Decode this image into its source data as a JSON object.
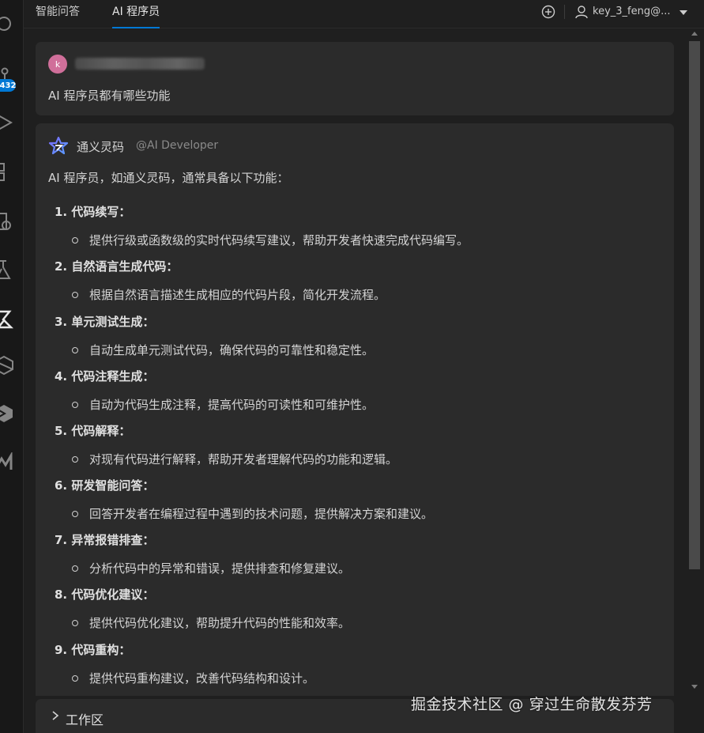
{
  "tabs": [
    {
      "label": "智能问答"
    },
    {
      "label": "AI 程序员"
    }
  ],
  "header": {
    "user_name": "key_3_feng@...",
    "add_icon": "add-circle-icon",
    "user_icon": "account-icon",
    "dropdown_icon": "caret-down-icon"
  },
  "activity_bar": {
    "badge": "432",
    "icons": [
      "search-icon",
      "source-control-icon",
      "run-debug-icon",
      "extensions-icon",
      "remote-icon",
      "testing-icon",
      "tongyi-lingma-icon",
      "hexagon-icon",
      "cube-icon",
      "chart-icon"
    ]
  },
  "question": {
    "avatar_letter": "k",
    "text": "AI 程序员都有哪些功能"
  },
  "answer": {
    "author": "通义灵码",
    "handle": "@AI Developer",
    "intro": "AI 程序员，如通义灵码，通常具备以下功能：",
    "items": [
      {
        "title": "1. 代码续写：",
        "desc": "提供行级或函数级的实时代码续写建议，帮助开发者快速完成代码编写。"
      },
      {
        "title": "2. 自然语言生成代码：",
        "desc": "根据自然语言描述生成相应的代码片段，简化开发流程。"
      },
      {
        "title": "3. 单元测试生成：",
        "desc": "自动生成单元测试代码，确保代码的可靠性和稳定性。"
      },
      {
        "title": "4. 代码注释生成：",
        "desc": "自动为代码生成注释，提高代码的可读性和可维护性。"
      },
      {
        "title": "5. 代码解释：",
        "desc": "对现有代码进行解释，帮助开发者理解代码的功能和逻辑。"
      },
      {
        "title": "6. 研发智能问答：",
        "desc": "回答开发者在编程过程中遇到的技术问题，提供解决方案和建议。"
      },
      {
        "title": "7. 异常报错排查：",
        "desc": "分析代码中的异常和错误，提供排查和修复建议。"
      },
      {
        "title": "8. 代码优化建议：",
        "desc": "提供代码优化建议，帮助提升代码的性能和效率。"
      },
      {
        "title": "9. 代码重构：",
        "desc": "提供代码重构建议，改善代码结构和设计。"
      }
    ]
  },
  "workspace": {
    "label": "工作区"
  },
  "watermark": "掘金技术社区 @ 穿过生命散发芬芳"
}
